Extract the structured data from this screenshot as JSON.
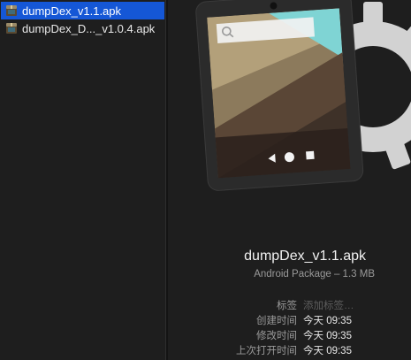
{
  "files": [
    {
      "name": "dumpDex_v1.1.apk",
      "selected": true,
      "icon": "apk-file-icon"
    },
    {
      "name": "dumpDex_D..._v1.0.4.apk",
      "selected": false,
      "icon": "apk-file-icon"
    }
  ],
  "preview": {
    "title": "dumpDex_v1.1.apk",
    "subtitle": "Android Package – 1.3 MB",
    "icon": "android-package-icon",
    "accent_color": "#7fd4d4"
  },
  "meta": {
    "tags_label": "标签",
    "tags_placeholder": "添加标签…",
    "created_label": "创建时间",
    "created_value": "今天 09:35",
    "modified_label": "修改时间",
    "modified_value": "今天 09:35",
    "opened_label": "上次打开时间",
    "opened_value": "今天 09:35"
  },
  "colors": {
    "selection": "#1557d6",
    "background": "#1e1e1e"
  }
}
